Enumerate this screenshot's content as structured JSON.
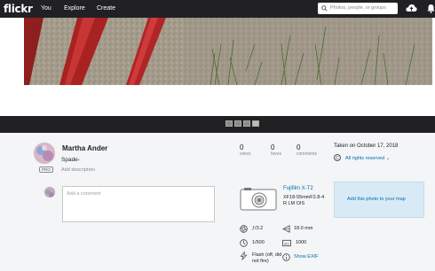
{
  "header": {
    "logo": "flickr",
    "nav": [
      "You",
      "Explore",
      "Create"
    ],
    "search_placeholder": "Photos, people, or groups"
  },
  "owner": {
    "name": "Martha Ander",
    "badge": "PRO"
  },
  "photo": {
    "title": "Spade-",
    "add_description": "Add description"
  },
  "comment": {
    "placeholder": "Add a comment"
  },
  "stats": [
    {
      "value": "0",
      "label": "views"
    },
    {
      "value": "0",
      "label": "faves"
    },
    {
      "value": "0",
      "label": "comments"
    }
  ],
  "taken": "Taken on October 17, 2018",
  "license": "All rights reserved",
  "license_icon": "C",
  "camera": {
    "name": "Fujifilm X-T2",
    "lens": "XF18-55mmF2.8-4 R LM OIS"
  },
  "map": {
    "label": "Add this photo to your map"
  },
  "exif": {
    "aperture": "ƒ/3.2",
    "focal_length": "18.0 mm",
    "shutter": "1/500",
    "iso": "1000",
    "flash": "Flash (off, did not fire)",
    "show_exif": "Show EXIF"
  },
  "colors": {
    "header_bg": "#212124",
    "link": "#006dac",
    "page_bg": "#f3f5f6"
  }
}
